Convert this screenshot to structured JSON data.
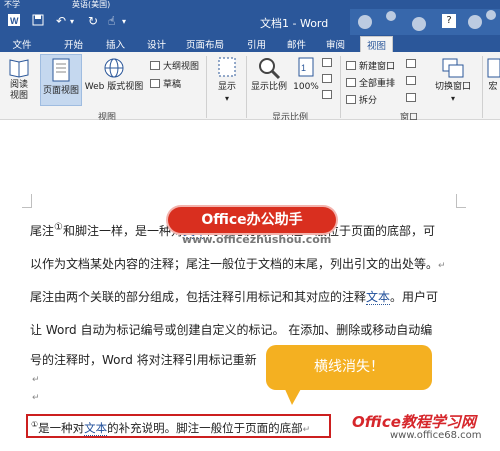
{
  "top": {
    "left_text": "不学",
    "lang_text": "英语(美国)"
  },
  "titlebar": {
    "title": "文档1 - Word",
    "help": "?"
  },
  "tabs": [
    "文件",
    "开始",
    "插入",
    "设计",
    "页面布局",
    "引用",
    "邮件",
    "审阅",
    "视图"
  ],
  "active_tab": "视图",
  "ribbon": {
    "views": {
      "read": "阅读\n视图",
      "print": "页面视图",
      "web": "Web 版式视图",
      "outline": "大纲视图",
      "draft": "草稿",
      "label": "视图"
    },
    "show": {
      "label": "显示"
    },
    "zoom": {
      "zoom": "显示比例",
      "hundred": "100%",
      "label": "显示比例"
    },
    "window": {
      "new_window": "新建窗口",
      "arrange_all": "全部重排",
      "split": "拆分",
      "switch": "切换窗口",
      "macro": "宏",
      "label": "窗口"
    }
  },
  "document": {
    "lines": [
      {
        "before": "尾注",
        "sup": "①",
        "after": "和脚注一样，是一种对",
        "link": "文本",
        "rest": "的补充说明。脚注一般位于页面的底部，可"
      },
      {
        "before": "以作为文档某处内容的注释；尾注一般位于文档的末尾，列出引文的出处等。",
        "link": "",
        "rest": ""
      },
      {
        "before": "尾注由两个关联的部分组成，包括注释引用标记和其对应的注释",
        "link": "文本",
        "rest": "。用户可"
      },
      {
        "before": "让 Word 自动为标记编号或创建自定义的标记。 在添加、删除或移动自动编",
        "link": "",
        "rest": ""
      },
      {
        "before": "号的注释时，Word 将对注释引用标记重新",
        "link": "",
        "rest": ""
      }
    ],
    "note_line": {
      "marker": "①",
      "before": "是一种对",
      "link": "文本",
      "after": "的补充说明。脚注一般位于页面的底部"
    },
    "para_mark": "↵"
  },
  "overlays": {
    "logo": "Office办公助手",
    "logo_url": "www.officezhushou.com",
    "callout": "横线消失！",
    "watermark": "Office教程学习网",
    "watermark_url": "www.office68.com"
  }
}
